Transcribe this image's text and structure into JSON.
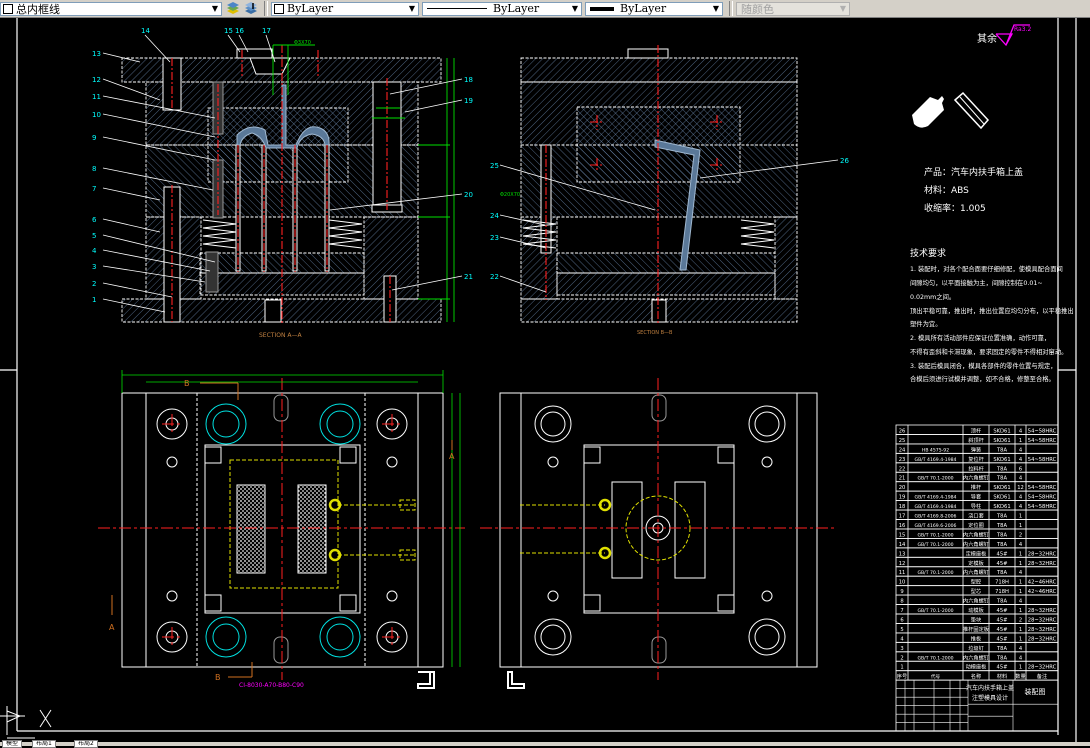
{
  "toolbar": {
    "layer_name": "总内框线",
    "color": "ByLayer",
    "linetype": "ByLayer",
    "lineweight": "ByLayer",
    "plotstyle": "随颜色",
    "icons": [
      "layer-make-current-icon",
      "layer-previous-icon"
    ]
  },
  "colors": {
    "background": "#000000",
    "callout": "#00ffff",
    "centerline": "#ff0000",
    "dimension": "#00ff00",
    "hatch": "#7090b8",
    "annotation": "#ff00ff",
    "section_label": "#c08040",
    "cooling": "#ffff00"
  },
  "views": {
    "section_a": "SECTION A—A",
    "section_b": "SECTION B—B",
    "cut_label_b": "B",
    "cut_label_a": "A",
    "mold_base_code": "CI-8030-A70-B80-C90",
    "dim_gate": "Φ3X70",
    "dim_b": "Φ20X70"
  },
  "callouts_a": {
    "left": [
      "1",
      "2",
      "3",
      "4",
      "5",
      "6",
      "7",
      "8",
      "9",
      "10",
      "11",
      "12",
      "13"
    ],
    "top": [
      "14",
      "15",
      "16",
      "17"
    ],
    "right": [
      "18",
      "19",
      "20",
      "21"
    ]
  },
  "callouts_b": {
    "left": [
      "25",
      "24",
      "23",
      "22"
    ],
    "right": [
      "26"
    ]
  },
  "roughness": {
    "label": "其余",
    "value": "Ra3.2"
  },
  "product_info": {
    "product": "产品：汽车内扶手箱上盖",
    "material": "材料：ABS",
    "shrinkage": "收缩率：1.005"
  },
  "tech_requirements": {
    "title": "技术要求",
    "lines": [
      "1. 装配时，对各个配合面要仔细修配，使模具配合面间",
      "间隙均匀，以平面接触为主，间隙控制在0.01~",
      "0.02mm之间。",
      "顶出平稳可靠，推出时，推出位置应均匀分布，以平稳推出",
      "塑件为宜。",
      "2. 模具所有活动部件应保证位置准确，动作可靠，",
      "不得有歪斜和卡滞现象，要求固定的零件不得相对窜动。",
      "3. 装配后模具闭合，模具各部件的零件位置与规定，",
      "合模后须进行试模并调整，如不合格，修整至合格。"
    ]
  },
  "bom": {
    "header": [
      "序号",
      "代号",
      "名称",
      "材料",
      "数量",
      "备注"
    ],
    "rows": [
      [
        "26",
        "",
        "顶杆",
        "SKD61",
        "4",
        "54~58HRC"
      ],
      [
        "25",
        "",
        "斜顶杆",
        "SKD61",
        "1",
        "54~58HRC"
      ],
      [
        "24",
        "HB 4575-92",
        "弹簧",
        "T8A",
        "4",
        ""
      ],
      [
        "23",
        "GB/T 4169.4-1984",
        "复位杆",
        "SKD61",
        "4",
        "54~58HRC"
      ],
      [
        "22",
        "",
        "拉料杆",
        "T8A",
        "6",
        ""
      ],
      [
        "21",
        "GB/T 70.1-2000",
        "内六角螺钉",
        "T8A",
        "4",
        ""
      ],
      [
        "20",
        "",
        "推杆",
        "SKD61",
        "12",
        "54~58HRC"
      ],
      [
        "19",
        "GB/T 4169.4-1984",
        "导套",
        "SKD61",
        "4",
        "54~58HRC"
      ],
      [
        "18",
        "GB/T 4169.4-1984",
        "导柱",
        "SKD61",
        "4",
        "54~58HRC"
      ],
      [
        "17",
        "GB/T 4169.8-2006",
        "浇口套",
        "T8A",
        "1",
        ""
      ],
      [
        "16",
        "GB/T 4169.6-2006",
        "定位圈",
        "T8A",
        "1",
        ""
      ],
      [
        "15",
        "GB/T 70.1-2000",
        "内六角螺钉",
        "T8A",
        "2",
        ""
      ],
      [
        "14",
        "GB/T 70.1-2000",
        "内六角螺钉",
        "T8A",
        "4",
        ""
      ],
      [
        "13",
        "",
        "定模座板",
        "45#",
        "1",
        "28~32HRC"
      ],
      [
        "12",
        "",
        "定模板",
        "45#",
        "1",
        "28~32HRC"
      ],
      [
        "11",
        "GB/T 70.1-2000",
        "内六角螺钉",
        "T8A",
        "4",
        ""
      ],
      [
        "10",
        "",
        "型腔",
        "718H",
        "1",
        "42~46HRC"
      ],
      [
        "9",
        "",
        "型芯",
        "718H",
        "1",
        "42~46HRC"
      ],
      [
        "8",
        "",
        "内六角螺钉",
        "T8A",
        "4",
        ""
      ],
      [
        "7",
        "GB/T 70.1-2000",
        "动模板",
        "45#",
        "1",
        "28~32HRC"
      ],
      [
        "6",
        "",
        "垫块",
        "45#",
        "2",
        "28~32HRC"
      ],
      [
        "5",
        "",
        "推杆固定板",
        "45#",
        "1",
        "28~32HRC"
      ],
      [
        "4",
        "",
        "推板",
        "45#",
        "1",
        "28~32HRC"
      ],
      [
        "3",
        "",
        "垃圾钉",
        "T8A",
        "4",
        ""
      ],
      [
        "2",
        "GB/T 70.1-2000",
        "内六角螺钉",
        "T8A",
        "4",
        ""
      ],
      [
        "1",
        "",
        "动模座板",
        "45#",
        "1",
        "28~32HRC"
      ]
    ]
  },
  "title_block": {
    "drawing_name_1": "汽车内扶手箱上盖",
    "drawing_name_2": "注塑模具设计",
    "drawing_type": "装配图"
  },
  "layout_tabs": [
    "模型",
    "布局1",
    "布局2"
  ]
}
